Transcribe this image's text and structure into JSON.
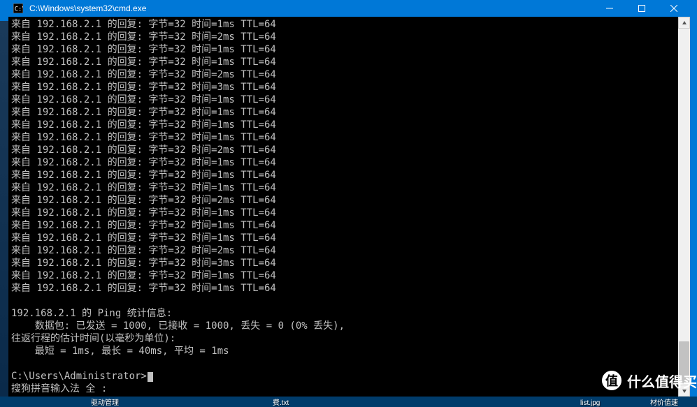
{
  "window": {
    "title": "C:\\Windows\\system32\\cmd.exe"
  },
  "ping": {
    "ip": "192.168.2.1",
    "bytes": 32,
    "ttl": 64,
    "replies": [
      {
        "time": "1ms"
      },
      {
        "time": "2ms"
      },
      {
        "time": "1ms"
      },
      {
        "time": "1ms"
      },
      {
        "time": "2ms"
      },
      {
        "time": "3ms"
      },
      {
        "time": "1ms"
      },
      {
        "time": "1ms"
      },
      {
        "time": "1ms"
      },
      {
        "time": "1ms"
      },
      {
        "time": "2ms"
      },
      {
        "time": "1ms"
      },
      {
        "time": "1ms"
      },
      {
        "time": "1ms"
      },
      {
        "time": "2ms"
      },
      {
        "time": "1ms"
      },
      {
        "time": "1ms"
      },
      {
        "time": "1ms"
      },
      {
        "time": "2ms"
      },
      {
        "time": "3ms"
      },
      {
        "time": "1ms"
      },
      {
        "time": "1ms"
      }
    ],
    "labels": {
      "reply_prefix": "来自 ",
      "reply_mid": " 的回复: 字节=",
      "time_label": " 时间=",
      "ttl_label": " TTL="
    },
    "stats": {
      "header_prefix": "192.168.2.1 的 Ping 统计信息:",
      "packets": "    数据包: 已发送 = 1000, 已接收 = 1000, 丢失 = 0 (0% 丢失),",
      "rtt_header": "往返行程的估计时间(以毫秒为单位):",
      "rtt_values": "    最短 = 1ms, 最长 = 40ms, 平均 = 1ms",
      "sent": 1000,
      "received": 1000,
      "lost": 0,
      "loss_pct": "0%",
      "min": "1ms",
      "max": "40ms",
      "avg": "1ms"
    }
  },
  "prompt": {
    "path": "C:\\Users\\Administrator>"
  },
  "ime": {
    "status": "搜狗拼音输入法 全 :"
  },
  "watermark": {
    "logo": "值",
    "text": "什么值得买"
  },
  "taskbar": {
    "items": [
      "驱动管理",
      "费.txt",
      "list.jpg",
      "材价值速"
    ]
  }
}
